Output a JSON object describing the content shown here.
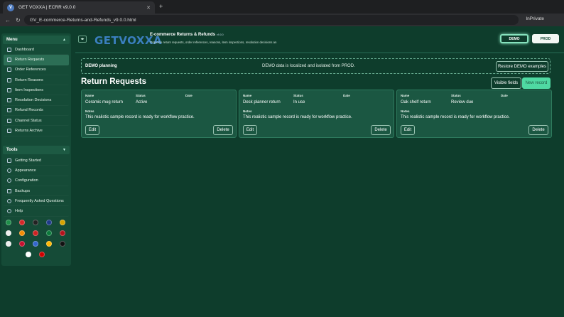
{
  "browser": {
    "tab_title": "GET VOXXA | ECRR v9.0.0",
    "tab_favicon": "V",
    "url": "GV_E-commerce-Returns-and-Refunds_v9.0.0.html",
    "private_label": "InPrivate"
  },
  "sidebar": {
    "menu_label": "Menu",
    "menu_items": [
      {
        "label": "Dashboard",
        "active": false
      },
      {
        "label": "Return Requests",
        "active": true
      },
      {
        "label": "Order References",
        "active": false
      },
      {
        "label": "Return Reasons",
        "active": false
      },
      {
        "label": "Item Inspections",
        "active": false
      },
      {
        "label": "Resolution Decisions",
        "active": false
      },
      {
        "label": "Refund Records",
        "active": false
      },
      {
        "label": "Channel Status",
        "active": false
      },
      {
        "label": "Returns Archive",
        "active": false
      }
    ],
    "tools_label": "Tools",
    "tools_items": [
      {
        "label": "Getting Started"
      },
      {
        "label": "Appearance"
      },
      {
        "label": "Configuration"
      },
      {
        "label": "Backups"
      },
      {
        "label": "Frequently Asked Questions"
      },
      {
        "label": "Help"
      }
    ],
    "flag_colors": [
      "#1f8f4a",
      "#d62828",
      "#222222",
      "#1e3a8a",
      "#d8a300",
      "#eeeeee",
      "#f48c06",
      "#cc2222",
      "#0b7a3b",
      "#b5121b",
      "#eeeeee",
      "#c8102e",
      "#3366cc",
      "#ffb703",
      "#111111",
      "#ffffff",
      "#d00000"
    ]
  },
  "header": {
    "logo_text": "GETVOXXA",
    "app_title": "E-commerce Returns & Refunds",
    "app_version": "v9.0.0",
    "app_subtitle": "Organize return requests, order references, reasons, item inspections, resolution decisions an",
    "env_demo": "DEMO",
    "env_prod": "PROD",
    "accent_color": "#86e2bd"
  },
  "banner": {
    "title": "DEMO planning",
    "message": "DEMO data is localized and isolated from PROD.",
    "restore_label": "Restore DEMO examples"
  },
  "section": {
    "title": "Return Requests",
    "visible_fields_label": "Visible fields",
    "new_record_label": "New record"
  },
  "records": [
    {
      "name_label": "Name",
      "status_label": "Status",
      "date_label": "Date",
      "name": "Ceramic mug return",
      "status": "Active",
      "date": "",
      "notes_label": "Notes",
      "notes": "This realistic sample record is ready for workflow practice.",
      "edit_label": "Edit",
      "delete_label": "Delete"
    },
    {
      "name_label": "Name",
      "status_label": "Status",
      "date_label": "Date",
      "name": "Desk planner return",
      "status": "In use",
      "date": "",
      "notes_label": "Notes",
      "notes": "This realistic sample record is ready for workflow practice.",
      "edit_label": "Edit",
      "delete_label": "Delete"
    },
    {
      "name_label": "Name",
      "status_label": "Status",
      "date_label": "Date",
      "name": "Oak shelf return",
      "status": "Review due",
      "date": "",
      "notes_label": "Notes",
      "notes": "This realistic sample record is ready for workflow practice.",
      "edit_label": "Edit",
      "delete_label": "Delete"
    }
  ]
}
